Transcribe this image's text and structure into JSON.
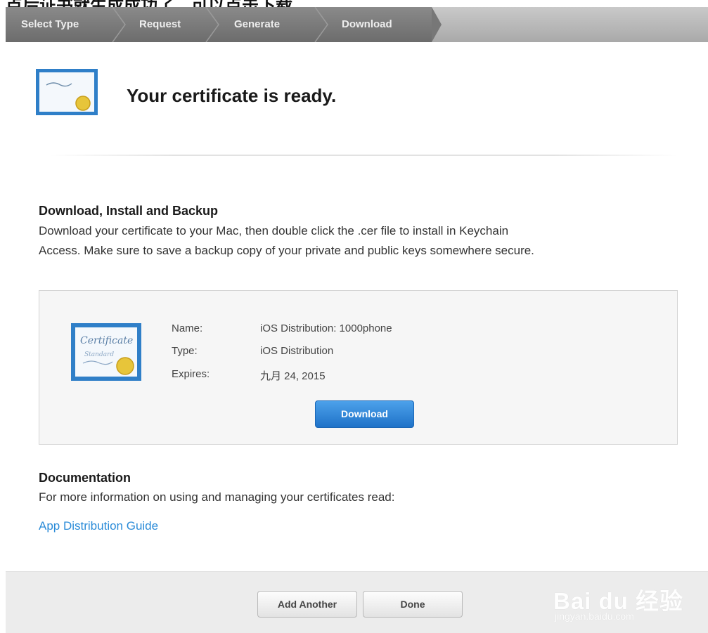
{
  "top_caption": "点后证书就生成成功了，可以点击下载",
  "breadcrumb": {
    "steps": [
      "Select Type",
      "Request",
      "Generate",
      "Download"
    ]
  },
  "header": {
    "title": "Your certificate is ready."
  },
  "download_section": {
    "heading": "Download, Install and Backup",
    "line1": "Download your certificate to your Mac, then double click the .cer file to install in Keychain",
    "line2": "Access. Make sure to save a backup copy of your private and public keys somewhere secure."
  },
  "certificate": {
    "name_label": "Name:",
    "name_value": "iOS Distribution: 1000phone",
    "type_label": "Type:",
    "type_value": "iOS Distribution",
    "expires_label": "Expires:",
    "expires_value": "九月 24, 2015",
    "download_label": "Download",
    "icon_text_top": "Certificate",
    "icon_text_bottom": "Standard"
  },
  "documentation": {
    "heading": "Documentation",
    "text": "For more information on using and managing your certificates read:",
    "link": "App Distribution Guide"
  },
  "footer": {
    "add_another_label": "Add Another",
    "done_label": "Done"
  },
  "watermark": {
    "main": "Bai du 经验",
    "sub": "jingyan.baidu.com"
  },
  "colors": {
    "accent_blue": "#2a8bd8",
    "button_blue": "#1f72c8",
    "crumb_dark": "#7a7a7a"
  }
}
